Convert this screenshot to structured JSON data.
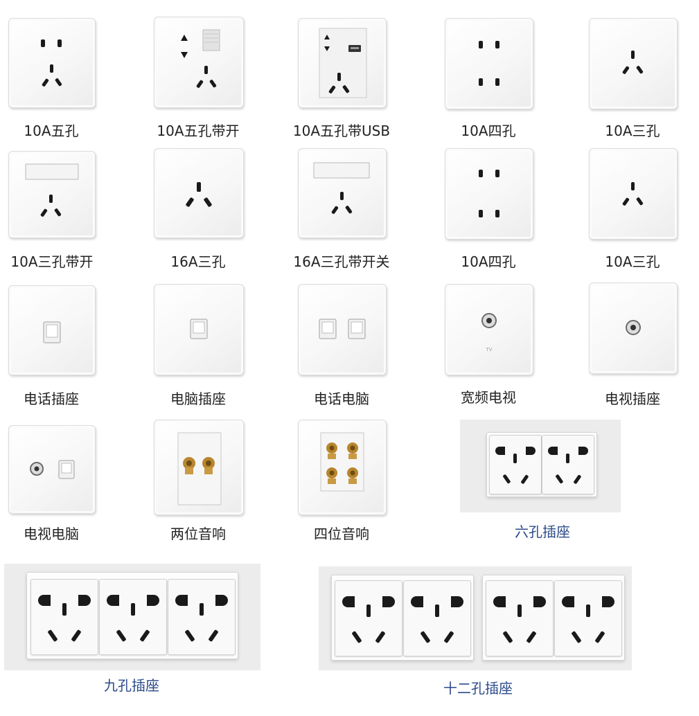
{
  "items": [
    {
      "label": "10A五孔"
    },
    {
      "label": "10A五孔带开"
    },
    {
      "label": "10A五孔带USB"
    },
    {
      "label": "10A四孔"
    },
    {
      "label": "10A三孔"
    },
    {
      "label": "10A三孔带开"
    },
    {
      "label": "16A三孔"
    },
    {
      "label": "16A三孔带开关"
    },
    {
      "label": "10A四孔"
    },
    {
      "label": "10A三孔"
    },
    {
      "label": "电话插座"
    },
    {
      "label": "电脑插座"
    },
    {
      "label": "电话电脑"
    },
    {
      "label": "宽频电视",
      "plate_text": "TV"
    },
    {
      "label": "电视插座"
    },
    {
      "label": "电视电脑"
    },
    {
      "label": "两位音响"
    },
    {
      "label": "四位音响"
    },
    {
      "label": "六孔插座"
    },
    {
      "label": "九孔插座"
    },
    {
      "label": "十二孔插座"
    }
  ],
  "colors": {
    "label": "#222222",
    "label_accent": "#2b4a8a",
    "hole": "#1a1a1a",
    "brass": "#b8862e"
  }
}
